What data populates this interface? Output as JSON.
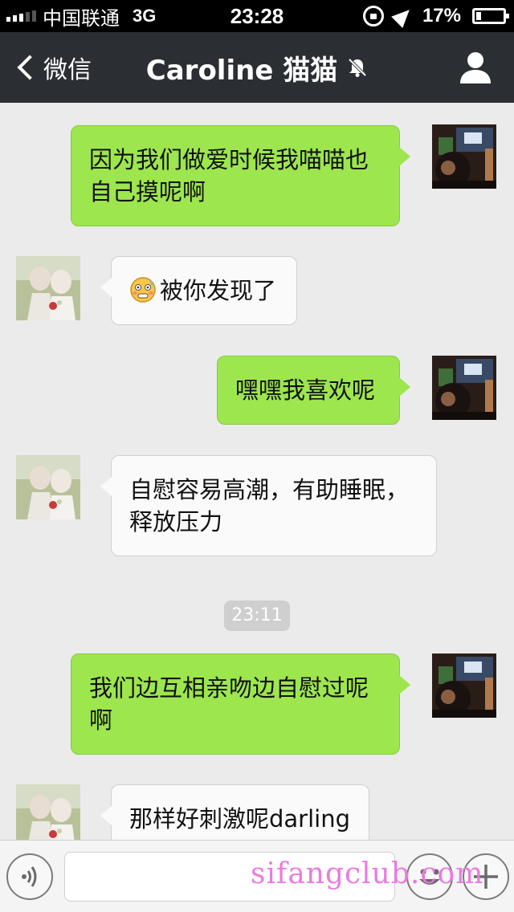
{
  "status": {
    "carrier": "中国联通",
    "network": "3G",
    "time": "23:28",
    "battery": "17%",
    "battery_level": 0.17
  },
  "nav": {
    "back_label": "微信",
    "title": "Caroline 猫猫"
  },
  "messages": [
    {
      "side": "out",
      "text": "因为我们做爱时候我喵喵也自己摸呢啊"
    },
    {
      "side": "in",
      "text": "被你发现了",
      "emoji": "flushed-face"
    },
    {
      "side": "out",
      "text": "嘿嘿我喜欢呢"
    },
    {
      "side": "in",
      "text": "自慰容易高潮，有助睡眠，释放压力"
    },
    {
      "side": "out",
      "text": "我们边互相亲吻边自慰过呢啊"
    },
    {
      "side": "in",
      "text": "那样好刺激呢darling"
    }
  ],
  "timestamp": "23:11",
  "input": {
    "value": "",
    "placeholder": ""
  },
  "watermark": "sifangclub.com",
  "colors": {
    "outgoing_bubble": "#9de64e",
    "incoming_bubble": "#fafafa",
    "nav_background": "#2b2e33",
    "watermark": "#ea7be0"
  }
}
